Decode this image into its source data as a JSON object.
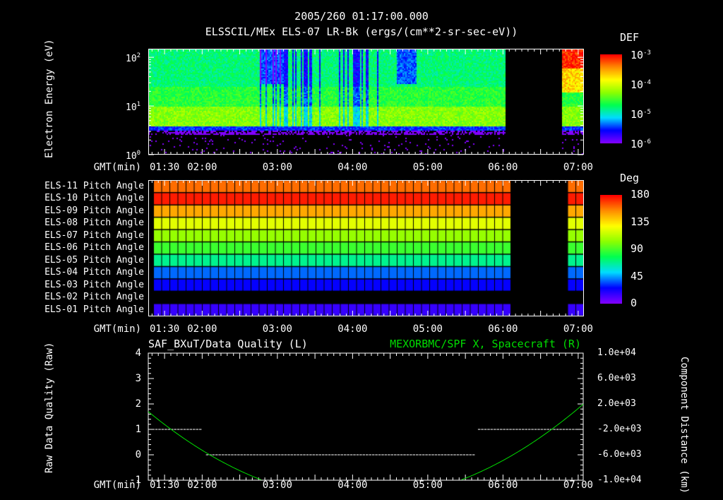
{
  "header": {
    "timestamp": "2005/260 01:17:00.000",
    "title": "ELSSCIL/MEx ELS-07 LR-Bk  (ergs/(cm**2-sr-sec-eV))"
  },
  "time_axis": {
    "label": "GMT(min)",
    "ticks": [
      "01:30",
      "02:00",
      "03:00",
      "04:00",
      "05:00",
      "06:00",
      "07:00"
    ],
    "tick_minutes": [
      90,
      120,
      180,
      240,
      300,
      360,
      420
    ],
    "range_minutes": [
      77,
      424
    ]
  },
  "colors": {
    "background": "#000000",
    "axes": "#ffffff",
    "spacecraft_line": "#00dd00"
  },
  "chart_data": [
    {
      "type": "heatmap",
      "name": "energy-spectrogram",
      "ylabel": "Electron Energy (eV)",
      "yscale": "log",
      "ylim": [
        1,
        150
      ],
      "y_ticks": [
        {
          "base": "10",
          "exp": "0"
        },
        {
          "base": "10",
          "exp": "1"
        },
        {
          "base": "10",
          "exp": "2"
        }
      ],
      "colorbar": {
        "label": "DEF",
        "scale": "log",
        "range": [
          1e-06,
          0.001
        ],
        "ticks": [
          {
            "base": "10",
            "exp": "-3"
          },
          {
            "base": "10",
            "exp": "-4"
          },
          {
            "base": "10",
            "exp": "-5"
          },
          {
            "base": "10",
            "exp": "-6"
          }
        ]
      },
      "data_gaps_minutes": [
        [
          361,
          406
        ]
      ],
      "low_energy_cutoff_eV": 4,
      "typical_log_DEF_by_energy": {
        "4-10eV": -4.3,
        "10-25eV": -4.6,
        "25-150eV": -4.8
      },
      "dropout_interval_minutes": [
        165,
        260
      ],
      "late_enhancement_log_DEF": -3.3
    },
    {
      "type": "heatmap",
      "name": "pitch-angle",
      "rows": [
        "ELS-11 Pitch Angle",
        "ELS-10 Pitch Angle",
        "ELS-09 Pitch Angle",
        "ELS-08 Pitch Angle",
        "ELS-07 Pitch Angle",
        "ELS-06 Pitch Angle",
        "ELS-05 Pitch Angle",
        "ELS-04 Pitch Angle",
        "ELS-03 Pitch Angle",
        "ELS-02 Pitch Angle",
        "ELS-01 Pitch Angle"
      ],
      "values_deg": [
        160,
        175,
        148,
        122,
        105,
        88,
        68,
        38,
        25,
        null,
        15
      ],
      "colorbar": {
        "label": "Deg",
        "range": [
          0,
          180
        ],
        "ticks": [
          "180",
          "135",
          "90",
          "45",
          "0"
        ]
      },
      "data_gaps_minutes": [
        [
          361,
          406
        ]
      ]
    },
    {
      "type": "line",
      "name": "data-quality-and-position",
      "left_title": "SAF_BXuT/Data Quality (L)",
      "right_title": "MEXORBMC/SPF X, Spacecraft (R)",
      "ylabel_left": "Raw Data Quality (Raw)",
      "ylabel_right": "Component Distance (km)",
      "ylim_left": [
        -1,
        4
      ],
      "ylim_right": [
        -10000,
        10000
      ],
      "left_ticks": [
        "4",
        "3",
        "2",
        "1",
        "0",
        "-1"
      ],
      "right_ticks": [
        "1.0e+04",
        "6.0e+03",
        "2.0e+03",
        "-2.0e+03",
        "-6.0e+03",
        "-1.0e+04"
      ],
      "series": [
        {
          "name": "Data Quality",
          "axis": "left",
          "segments": [
            {
              "x": [
                80,
                120
              ],
              "y": 1
            },
            {
              "x": [
                123,
                338
              ],
              "y": 0
            },
            {
              "x": [
                340,
                420
              ],
              "y": 1
            }
          ]
        },
        {
          "name": "SPF X",
          "axis": "right",
          "model": "parabola",
          "vertex_minute": 247,
          "vertex_km": -12975,
          "coef_km_per_min2": 0.4766
        }
      ]
    }
  ]
}
